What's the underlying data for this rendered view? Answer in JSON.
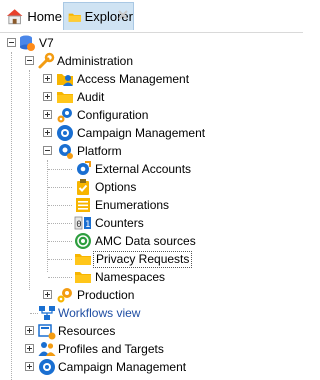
{
  "tabs": {
    "home_label": "Home",
    "explorer_label": "Explorer"
  },
  "tree": {
    "root": "V7",
    "administration": "Administration",
    "access_management": "Access Management",
    "audit": "Audit",
    "configuration": "Configuration",
    "campaign_management_admin": "Campaign Management",
    "platform": "Platform",
    "external_accounts": "External Accounts",
    "options": "Options",
    "enumerations": "Enumerations",
    "counters": "Counters",
    "amc_data_sources": "AMC Data sources",
    "privacy_requests": "Privacy Requests",
    "namespaces": "Namespaces",
    "production": "Production",
    "workflows_view": "Workflows view",
    "resources": "Resources",
    "profiles_and_targets": "Profiles and Targets",
    "campaign_management": "Campaign Management"
  },
  "colors": {
    "folder": "#f7b500",
    "gear_blue": "#1a6fd1",
    "link": "#1f4ea3",
    "tab_active": "#cfe3f3"
  }
}
